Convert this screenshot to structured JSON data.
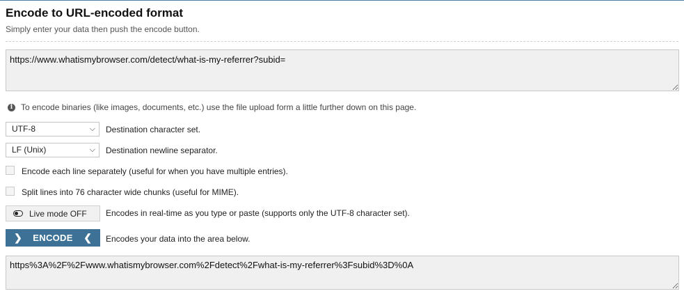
{
  "header": {
    "title": "Encode to URL-encoded format",
    "subtitle": "Simply enter your data then push the encode button."
  },
  "input": {
    "value": "https://www.whatismybrowser.com/detect/what-is-my-referrer?subid="
  },
  "info": {
    "icon": "info-icon",
    "text": "To encode binaries (like images, documents, etc.) use the file upload form a little further down on this page."
  },
  "options": {
    "charset_select": "UTF-8",
    "charset_label": "Destination character set.",
    "newline_select": "LF (Unix)",
    "newline_label": "Destination newline separator.",
    "encode_each_line_label": "Encode each line separately (useful for when you have multiple entries).",
    "split_lines_label": "Split lines into 76 character wide chunks (useful for MIME).",
    "live_mode_label": "Live mode OFF",
    "live_mode_desc": "Encodes in real-time as you type or paste (supports only the UTF-8 character set)."
  },
  "encode": {
    "button_label": "ENCODE",
    "desc": "Encodes your data into the area below."
  },
  "output": {
    "value": "https%3A%2F%2Fwww.whatismybrowser.com%2Fdetect%2Fwhat-is-my-referrer%3Fsubid%3D%0A"
  },
  "colors": {
    "accent": "#3d7296",
    "textarea_bg": "#f0f0f0"
  }
}
